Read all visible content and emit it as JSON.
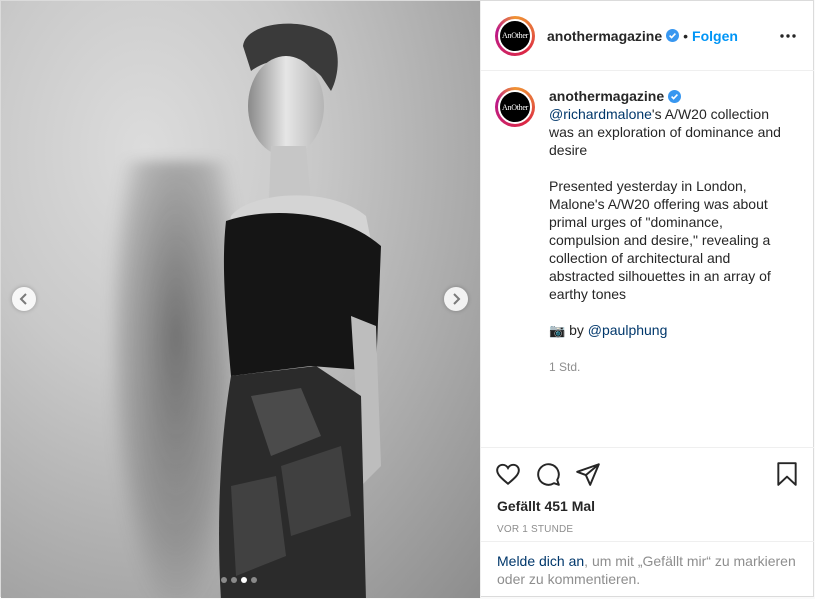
{
  "post": {
    "username": "anothermagazine",
    "avatar_text": "AnOther",
    "follow_label": "Folgen",
    "separator": "•"
  },
  "caption": {
    "mention": "@richardmalone",
    "headline_rest": "'s A/W20 collection was an exploration of dominance and desire",
    "body": "Presented yesterday in London, Malone's A/W20 offering was about primal urges of \"dominance, compulsion and desire,\" revealing a collection of architectural and abstracted silhouettes in an array of earthy tones",
    "photo_icon": "📷",
    "credit_prefix": "by",
    "credit_mention": "@paulphung",
    "relative_time": "1 Std."
  },
  "engagement": {
    "likes": "Gefällt 451 Mal",
    "timestamp": "VOR 1 STUNDE"
  },
  "login_prompt": {
    "link": "Melde dich an",
    "rest": ", um mit „Gefällt mir“ zu markieren oder zu kommentieren."
  },
  "carousel": {
    "total_slides": 4,
    "active_slide": 3
  },
  "icons": {
    "verified": "verified-badge-icon",
    "more": "more-options-icon",
    "like": "heart-icon",
    "comment": "comment-icon",
    "share": "share-icon",
    "save": "bookmark-icon",
    "prev": "chevron-left-icon",
    "next": "chevron-right-icon"
  },
  "colors": {
    "accent": "#0095f6",
    "link": "#00376b",
    "muted": "#8e8e8e",
    "verified": "#3897f0"
  }
}
